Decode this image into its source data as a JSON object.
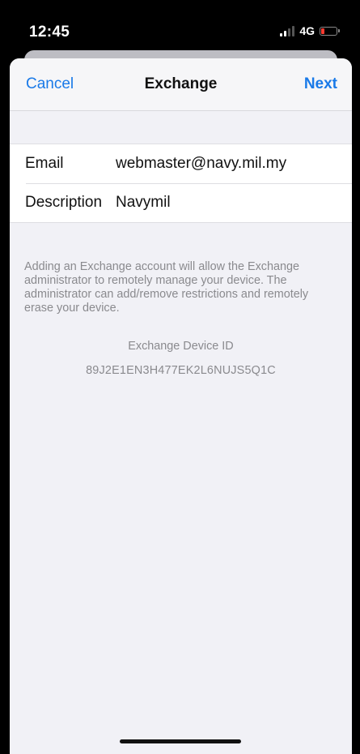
{
  "status_bar": {
    "time": "12:45",
    "network": "4G",
    "battery_color": "#ff3b30"
  },
  "nav": {
    "cancel_label": "Cancel",
    "title": "Exchange",
    "next_label": "Next"
  },
  "form": {
    "email_label": "Email",
    "email_value": "webmaster@navy.mil.my",
    "description_label": "Description",
    "description_value": "Navymil"
  },
  "info_text": "Adding an Exchange account will allow the Exchange administrator to remotely manage your device. The administrator can add/remove restrictions and remotely erase your device.",
  "device": {
    "label": "Exchange Device ID",
    "id": "89J2E1EN3H477EK2L6NUJS5Q1C"
  },
  "colors": {
    "accent": "#1a7ae8",
    "background": "#f1f1f6"
  }
}
